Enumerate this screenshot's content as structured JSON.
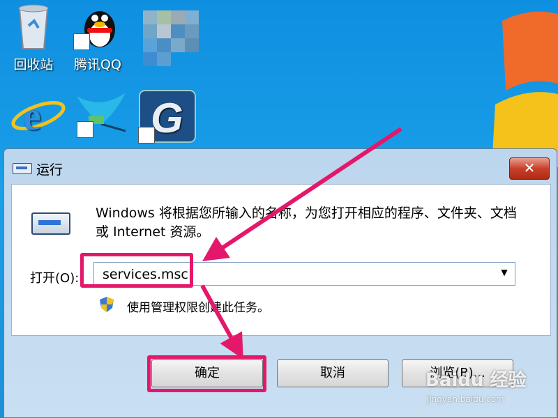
{
  "desktop": {
    "icons": [
      {
        "label": "回收站",
        "icon": "recycle-bin-icon"
      },
      {
        "label": "腾讯QQ",
        "icon": "qq-penguin-icon"
      },
      {
        "label": "",
        "icon": "pixelated-icon"
      },
      {
        "label": "",
        "icon": "internet-explorer-icon"
      },
      {
        "label": "",
        "icon": "bird-lite-app-icon"
      },
      {
        "label": "",
        "icon": "g-app-icon"
      }
    ]
  },
  "dialog": {
    "title": "运行",
    "close_label": "✕",
    "description": "Windows 将根据您所输入的名称，为您打开相应的程序、文件夹、文档或 Internet 资源。",
    "open_label": "打开(O):",
    "open_value": "services.msc",
    "admin_note": "使用管理权限创建此任务。",
    "buttons": {
      "ok": "确定",
      "cancel": "取消",
      "browse": "浏览(B)..."
    }
  },
  "annotation": {
    "color": "#e4186a"
  },
  "watermark": {
    "text": "Baidu 经验",
    "sub": "jingyan.baidu.com"
  }
}
